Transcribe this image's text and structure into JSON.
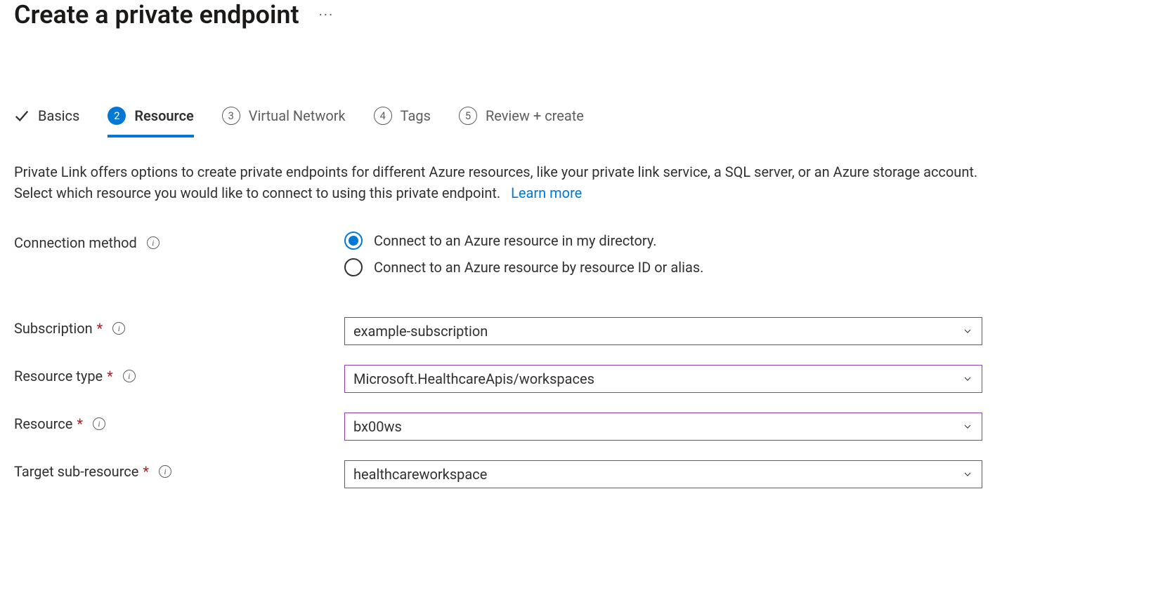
{
  "page": {
    "title": "Create a private endpoint"
  },
  "tabs": {
    "basics": "Basics",
    "resource_num": "2",
    "resource": "Resource",
    "vnet_num": "3",
    "vnet": "Virtual Network",
    "tags_num": "4",
    "tags": "Tags",
    "review_num": "5",
    "review": "Review + create"
  },
  "intro": {
    "text": "Private Link offers options to create private endpoints for different Azure resources, like your private link service, a SQL server, or an Azure storage account. Select which resource you would like to connect to using this private endpoint.",
    "learn_more": "Learn more"
  },
  "form": {
    "connection_method": {
      "label": "Connection method",
      "option1": "Connect to an Azure resource in my directory.",
      "option2": "Connect to an Azure resource by resource ID or alias."
    },
    "subscription": {
      "label": "Subscription",
      "value": "example-subscription"
    },
    "resource_type": {
      "label": "Resource type",
      "value": "Microsoft.HealthcareApis/workspaces"
    },
    "resource": {
      "label": "Resource",
      "value": "bx00ws"
    },
    "target_sub_resource": {
      "label": "Target sub-resource",
      "value": "healthcareworkspace"
    }
  }
}
